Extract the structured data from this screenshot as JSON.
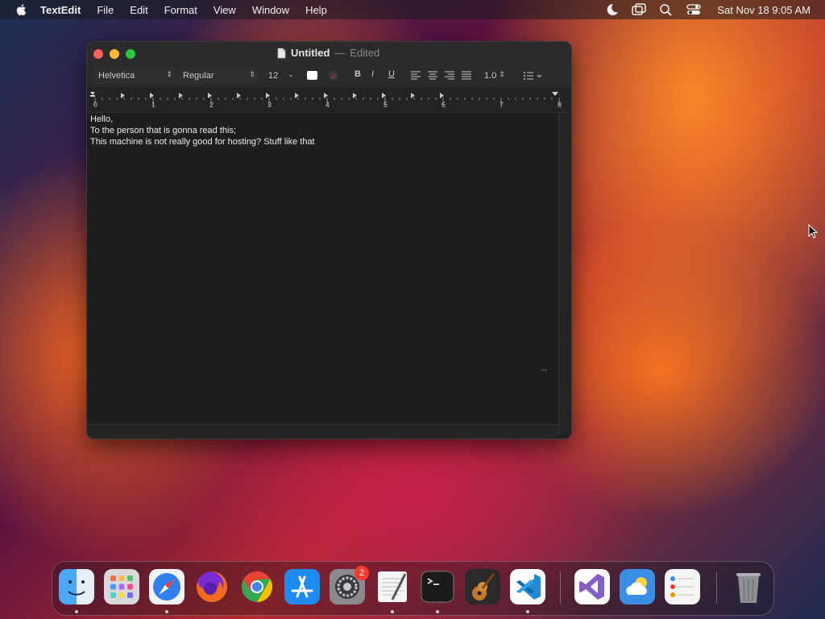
{
  "menubar": {
    "app_name": "TextEdit",
    "items": [
      "File",
      "Edit",
      "Format",
      "View",
      "Window",
      "Help"
    ],
    "clock": "Sat Nov 18  9:05 AM"
  },
  "window": {
    "title": "Untitled",
    "separator": "—",
    "status": "Edited",
    "toolbar": {
      "font": "Helvetica",
      "style": "Regular",
      "size": "12",
      "bold": "B",
      "italic": "I",
      "underline": "U",
      "line_spacing": "1.0"
    },
    "ruler_numbers": [
      "0",
      "1",
      "2",
      "3",
      "4",
      "5",
      "6",
      "7",
      "8"
    ],
    "lines": [
      "Hello,",
      "To the person that is gonna read this;",
      "This machine is not really good for hosting? Stuff like that"
    ],
    "marker": "--"
  },
  "dock": {
    "apps": [
      {
        "name": "finder-icon",
        "color": "#4aa8f5"
      },
      {
        "name": "launchpad-icon",
        "color": "#e0e0e0"
      },
      {
        "name": "safari-icon",
        "color": "#2f7ff0"
      },
      {
        "name": "firefox-icon",
        "color": "#f26a1b"
      },
      {
        "name": "chrome-icon",
        "color": "#34a853"
      },
      {
        "name": "app-store-icon",
        "color": "#1e8bf5"
      },
      {
        "name": "system-settings-icon",
        "color": "#8a8a8e"
      },
      {
        "name": "textedit-icon",
        "color": "#f2f2f2"
      },
      {
        "name": "terminal-icon",
        "color": "#1b1b1b"
      },
      {
        "name": "garageband-icon",
        "color": "#c4792c"
      },
      {
        "name": "vscode-icon",
        "color": "#1f8ad2"
      },
      {
        "name": "visual-studio-icon",
        "color": "#865fc5"
      },
      {
        "name": "weather-icon",
        "color": "#3a8ee6"
      },
      {
        "name": "reminders-icon",
        "color": "#f5f5f5"
      },
      {
        "name": "trash-icon",
        "color": "#9a9a9a"
      }
    ],
    "badge": "2"
  }
}
